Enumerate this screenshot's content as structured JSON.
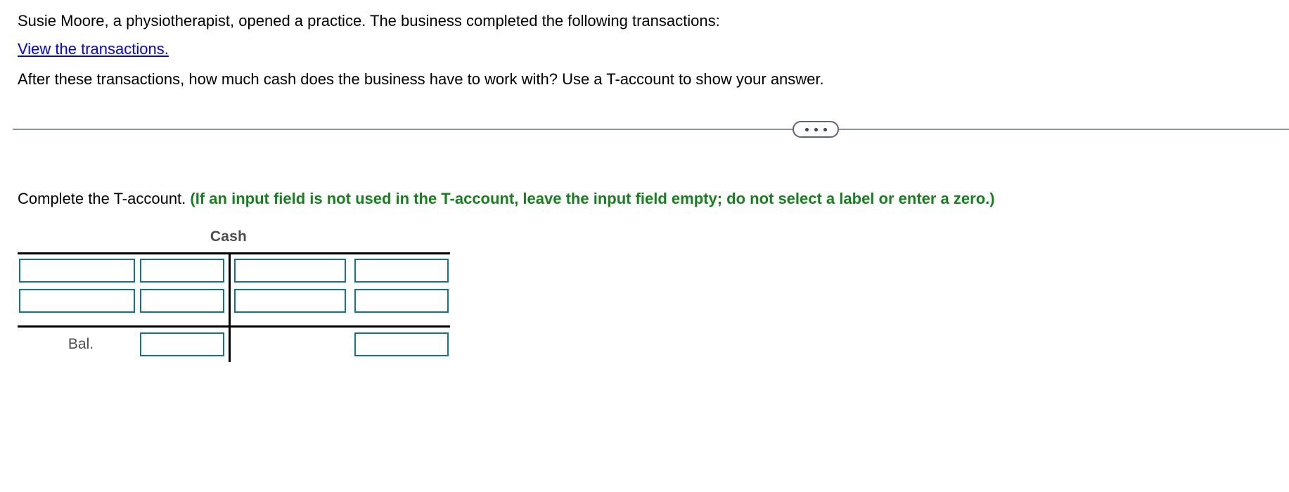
{
  "problem": {
    "line1": "Susie Moore, a physiotherapist, opened a practice. The business completed the following transactions:",
    "link_text": "View the transactions.",
    "line2": "After these transactions, how much cash does the business have to work with? Use a T-account to show your answer."
  },
  "divider": {
    "expander_icon": "ellipsis-icon",
    "dot_count": 3,
    "line_color": "#8b93a6",
    "pill_border_color": "#5a6475"
  },
  "instruction": {
    "prompt": "Complete the T-account.",
    "hint": "(If an input field is not used in the T-account, leave the input field empty; do not select a label or enter a zero.)",
    "hint_color": "#16801d"
  },
  "t_account": {
    "title": "Cash",
    "title_color": "#4d4d4d",
    "rule_color": "#000000",
    "input_border_color": "#0e7490",
    "balance_label": "Bal.",
    "debit_side": {
      "rows": [
        {
          "label_value": "",
          "label_placeholder": "",
          "amount_value": "",
          "amount_placeholder": ""
        },
        {
          "label_value": "",
          "label_placeholder": "",
          "amount_value": "",
          "amount_placeholder": ""
        }
      ],
      "balance_value": "",
      "balance_placeholder": ""
    },
    "credit_side": {
      "rows": [
        {
          "label_value": "",
          "label_placeholder": "",
          "amount_value": "",
          "amount_placeholder": ""
        },
        {
          "label_value": "",
          "label_placeholder": "",
          "amount_value": "",
          "amount_placeholder": ""
        }
      ],
      "balance_value": "",
      "balance_placeholder": ""
    }
  }
}
